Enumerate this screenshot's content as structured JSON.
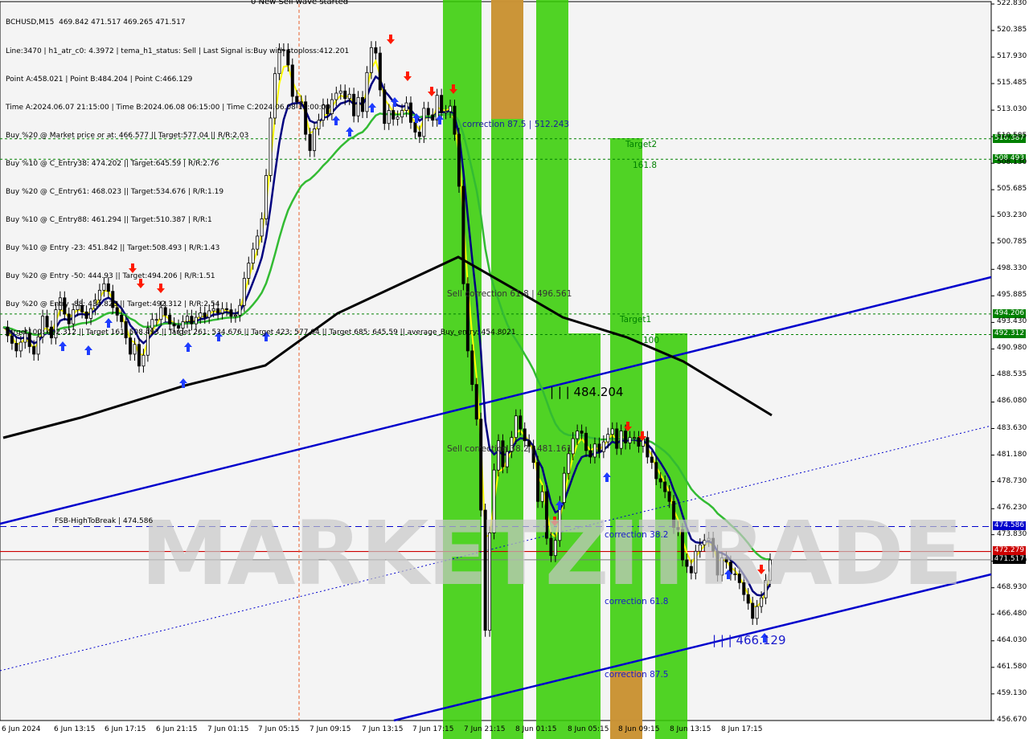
{
  "window": {
    "symbol_line": "BCHUSD,M15  469.842 471.517 469.265 471.517"
  },
  "info_lines": [
    "Line:3470 | h1_atr_c0: 4.3972 | tema_h1_status: Sell | Last Signal is:Buy with stoploss:412.201",
    "Point A:458.021 | Point B:484.204 | Point C:466.129",
    "Time A:2024.06.07 21:15:00 | Time B:2024.06.08 06:15:00 | Time C:2024.06.08 19:00:00",
    "Buy %20 @ Market price or at: 466.577 || Target:577.04 || R/R:2.03",
    "Buy %10 @ C_Entry38: 474.202 || Target:645.59 | R/R:2.76",
    "Buy %20 @ C_Entry61: 468.023 || Target:534.676 | R/R:1.19",
    "Buy %10 @ C_Entry88: 461.294 || Target:510.387 | R/R:1",
    "Buy %10 @ Entry -23: 451.842 || Target:508.493 | R/R:1.43",
    "Buy %20 @ Entry -50: 444.93 || Target:494.206 | R/R:1.51",
    "Buy %20 @ Entry -88: 434.823 || Target:492.312 | R/R:2.54",
    "Target100: 492.312 || Target 161: 508.493 || Target 261: 534.676 || Target 423: 577.04 || Target 685: 645.59 || average_Buy_entry: 454.8021"
  ],
  "signal_text": "0 New Sell wave started",
  "watermark": "MARKETZITRADE",
  "annotations": {
    "correction_875_top": "correction 87.5 | 512.243",
    "target2": "Target2",
    "t1618": "161.8",
    "target1": "Target1",
    "t100": "100",
    "sell_corr_61": "Sell correction 61.8 | 496.561",
    "point_b": "| | | 484.204",
    "sell_corr_38": "Sell correction 38.2 | 481.161",
    "fsb": "FSB-HighToBreak | 474.586",
    "corr_382": "correction 38.2",
    "corr_618": "correction 61.8",
    "corr_875": "correction 87.5",
    "point_c": "| | | 466.129"
  },
  "price_boxes": {
    "p510": "510.387",
    "p508": "508.493",
    "p494": "494.206",
    "p492": "492.312",
    "p474": "474.586",
    "p472": "472.279",
    "p471": "471.517"
  },
  "colors": {
    "green_zone": "#33cc00",
    "orange_zone": "#e08a3c",
    "trend_blue": "#0000cc",
    "ma_black": "#000000",
    "ma_green": "#33bb33",
    "ma_yellow": "#ffff00",
    "ma_navy": "#000080",
    "level_green": "#008000",
    "level_red": "#cc0000",
    "candle": "#000000"
  },
  "chart_data": {
    "type": "candlestick",
    "symbol": "BCHUSD",
    "timeframe": "M15",
    "ylim": [
      456.67,
      522.83
    ],
    "y_ticks": [
      "522.830",
      "520.385",
      "517.930",
      "515.485",
      "513.030",
      "510.585",
      "508.130",
      "505.685",
      "503.230",
      "500.785",
      "498.330",
      "495.885",
      "493.430",
      "490.980",
      "488.535",
      "486.080",
      "483.630",
      "481.180",
      "478.730",
      "476.230",
      "473.830",
      "471.380",
      "468.930",
      "466.480",
      "464.030",
      "461.580",
      "459.130",
      "456.670"
    ],
    "x_ticks": [
      "6 Jun 2024",
      "6 Jun 13:15",
      "6 Jun 17:15",
      "6 Jun 21:15",
      "7 Jun 01:15",
      "7 Jun 05:15",
      "7 Jun 09:15",
      "7 Jun 13:15",
      "7 Jun 17:15",
      "7 Jun 21:15",
      "8 Jun 01:15",
      "8 Jun 05:15",
      "8 Jun 09:15",
      "8 Jun 13:15",
      "8 Jun 17:15"
    ],
    "price_path": [
      493.0,
      492.2,
      491.5,
      490.8,
      491.6,
      492.4,
      491.2,
      490.5,
      492.1,
      494.0,
      493.0,
      492.0,
      494.6,
      495.7,
      494.2,
      493.3,
      494.6,
      495.0,
      494.4,
      493.8,
      494.7,
      495.5,
      496.4,
      497.0,
      496.3,
      494.8,
      494.1,
      493.5,
      492.0,
      490.5,
      491.4,
      489.4,
      490.4,
      492.9,
      493.7,
      493.7,
      494.8,
      494.1,
      493.3,
      493.1,
      492.9,
      493.5,
      494.0,
      493.3,
      493.9,
      494.3,
      493.9,
      494.5,
      494.7,
      494.3,
      494.7,
      494.6,
      494.0,
      494.1,
      495.0,
      497.5,
      498.9,
      500.2,
      501.4,
      503.0,
      507.0,
      512.3,
      516.4,
      518.6,
      518.6,
      517.2,
      514.3,
      513.8,
      513.8,
      510.8,
      509.3,
      511.3,
      512.1,
      513.5,
      512.7,
      514.0,
      514.6,
      514.8,
      514.1,
      514.5,
      512.5,
      514.2,
      512.9,
      516.5,
      518.8,
      518.3,
      514.9,
      511.8,
      513.0,
      512.2,
      512.4,
      513.0,
      513.7,
      511.9,
      511.0,
      510.6,
      513.2,
      512.6,
      512.1,
      514.4,
      512.8,
      512.9,
      513.4,
      510.8,
      506.0,
      497.0,
      490.8,
      487.7,
      484.5,
      476.1,
      465.0,
      474.0,
      479.8,
      482.5,
      480.1,
      481.5,
      482.8,
      484.8,
      483.6,
      482.5,
      482.0,
      480.5,
      476.9,
      477.8,
      473.5,
      471.9,
      473.3,
      476.8,
      479.5,
      481.3,
      482.7,
      483.4,
      483.2,
      481.6,
      481.0,
      482.2,
      481.5,
      482.4,
      483.1,
      483.6,
      481.8,
      483.4,
      482.3,
      482.8,
      482.8,
      482.0,
      482.8,
      481.0,
      480.5,
      479.0,
      478.7,
      477.8,
      476.9,
      474.5,
      474.3,
      471.5,
      470.9,
      470.3,
      472.3,
      472.9,
      473.3,
      473.5,
      472.3,
      470.1,
      471.7,
      471.3,
      470.2,
      470.2,
      469.4,
      468.3,
      467.5,
      466.1,
      467.2,
      468.0,
      469.6,
      471.5
    ],
    "series": [
      {
        "name": "Point A",
        "values": [
          458.021
        ]
      },
      {
        "name": "Point B",
        "values": [
          484.204
        ]
      },
      {
        "name": "Point C",
        "values": [
          466.129
        ]
      }
    ],
    "levels": [
      {
        "name": "Target2",
        "value": 510.387
      },
      {
        "name": "161.8",
        "value": 508.493
      },
      {
        "name": "Target1",
        "value": 494.206
      },
      {
        "name": "100",
        "value": 492.312
      },
      {
        "name": "FSB-HighToBreak",
        "value": 474.586
      },
      {
        "name": "stoploss line",
        "value": 472.279
      },
      {
        "name": "last price",
        "value": 471.517
      }
    ],
    "grid": false
  }
}
